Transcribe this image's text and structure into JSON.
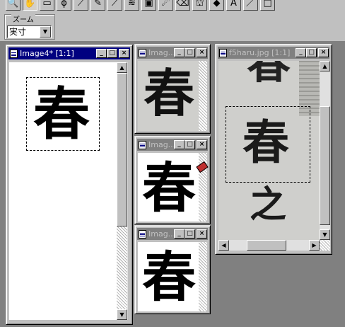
{
  "toolbar": {
    "tools": [
      {
        "icon": "magnifier-icon",
        "glyph": "🔍"
      },
      {
        "icon": "hand-icon",
        "glyph": "✋",
        "pressed": true
      },
      {
        "icon": "rect-select-icon",
        "glyph": "▭"
      },
      {
        "icon": "lasso-icon",
        "glyph": "ϕ"
      },
      {
        "icon": "eyedropper-icon",
        "glyph": "⟋"
      },
      {
        "icon": "pencil-icon",
        "glyph": "✎"
      },
      {
        "icon": "brush-icon",
        "glyph": "⟋"
      },
      {
        "icon": "clone-stamp-icon",
        "glyph": "≋"
      },
      {
        "icon": "color-replace-icon",
        "glyph": "▣"
      },
      {
        "icon": "retouch-icon",
        "glyph": "☄"
      },
      {
        "icon": "eraser-icon",
        "glyph": "⌫"
      },
      {
        "icon": "picture-tube-icon",
        "glyph": "⛫"
      },
      {
        "icon": "flood-fill-icon",
        "glyph": "◆"
      },
      {
        "icon": "text-tool-icon",
        "glyph": "A"
      },
      {
        "icon": "line-tool-icon",
        "glyph": "／"
      },
      {
        "icon": "shape-tool-icon",
        "glyph": "□"
      }
    ],
    "zoom_label": "ズーム",
    "zoom_value": "実寸",
    "accent": "#000080"
  },
  "windows": {
    "image4": {
      "title": "Image4* [1:1]",
      "character": "春"
    },
    "small1": {
      "title": "Imag...",
      "character": "春"
    },
    "small2": {
      "title": "Imag...",
      "character": "春"
    },
    "small3": {
      "title": "Imag...",
      "character": "春"
    },
    "f5haru": {
      "title": "f5haru.jpg [1:1]",
      "characters": [
        "春",
        "春",
        "之"
      ]
    }
  },
  "caption_buttons": {
    "minimize": "_",
    "maximize": "□",
    "close": "×"
  },
  "scroll_arrows": {
    "up": "▲",
    "down": "▼",
    "left": "◀",
    "right": "▶"
  }
}
